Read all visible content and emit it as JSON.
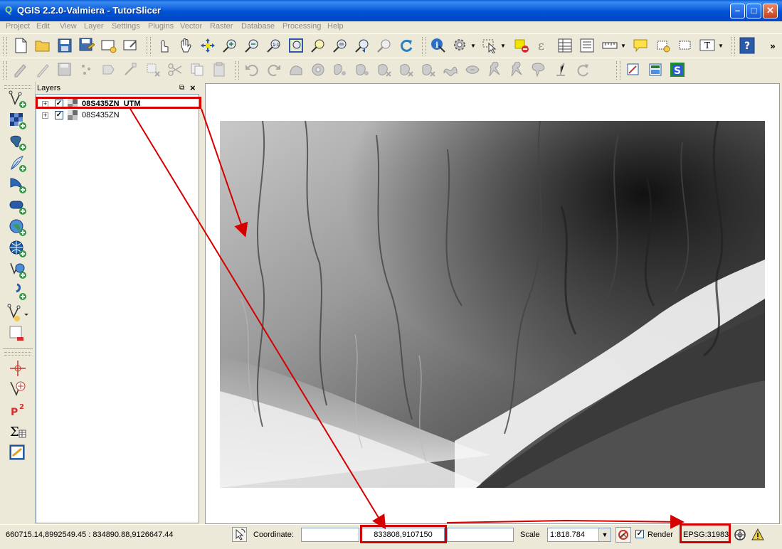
{
  "window": {
    "title": "QGIS 2.2.0-Valmiera - TutorSlicer",
    "app_icon": "qgis-icon",
    "controls": [
      "minimize-icon",
      "maximize-icon",
      "close-icon"
    ]
  },
  "menu": [
    "Project",
    "Edit",
    "View",
    "Layer",
    "Settings",
    "Plugins",
    "Vector",
    "Raster",
    "Database",
    "Processing",
    "Help"
  ],
  "layers_panel": {
    "title": "Layers",
    "layers": [
      {
        "name": "08S435ZN_UTM",
        "checked": true,
        "expander": "+",
        "selected": true
      },
      {
        "name": "08S435ZN",
        "checked": true,
        "expander": "+",
        "selected": false
      }
    ]
  },
  "status": {
    "extent": "660715.14,8992549.45 : 834890.88,9126647.44",
    "coordinate_label": "Coordinate:",
    "coordinate_value": "833808,9107150",
    "scale_label": "Scale",
    "scale_value": "1:818.784",
    "render_label": "Render",
    "render_checked": true,
    "crs": "EPSG:31983"
  },
  "colors": {
    "titlebar": "#0054e3",
    "highlight": "#d40000",
    "chrome": "#ece9d8"
  }
}
